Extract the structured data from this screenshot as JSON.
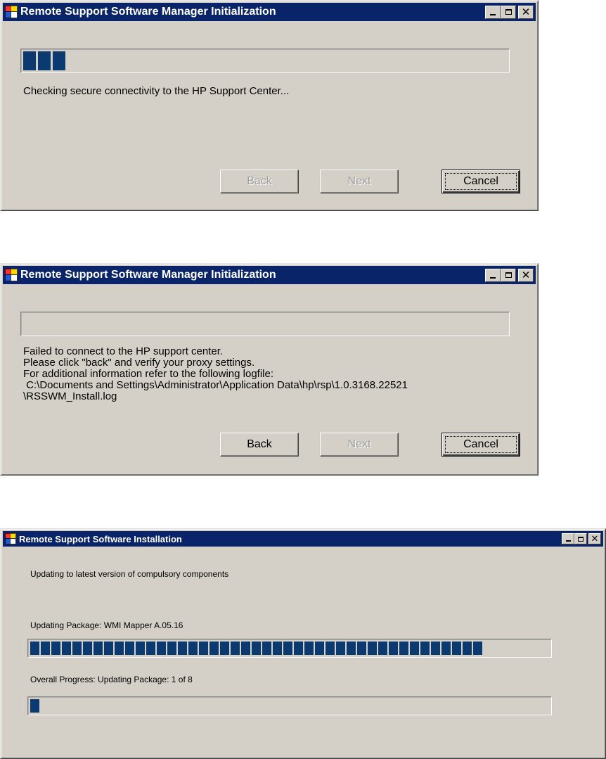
{
  "colors": {
    "titlebar": "#0a246a",
    "progress_fill": "#0a3a70",
    "window_face": "#d4d0c8"
  },
  "windows": [
    {
      "title": "Remote Support Software Manager Initialization",
      "progress_fraction": 0.09,
      "message_lines": [
        "Checking secure connectivity to the HP Support Center..."
      ],
      "buttons": {
        "back": "Back",
        "next": "Next",
        "cancel": "Cancel"
      },
      "back_enabled": false,
      "next_enabled": false
    },
    {
      "title": "Remote Support Software Manager Initialization",
      "progress_fraction": 0,
      "message_lines": [
        "Failed to connect to the HP support center.",
        "Please click \"back\" and verify your proxy settings.",
        "For additional information refer to the following logfile:",
        " C:\\Documents and Settings\\Administrator\\Application Data\\hp\\rsp\\1.0.3168.22521",
        "\\RSSWM_Install.log"
      ],
      "buttons": {
        "back": "Back",
        "next": "Next",
        "cancel": "Cancel"
      },
      "back_enabled": true,
      "next_enabled": false
    },
    {
      "title": "Remote Support Software Installation",
      "status": "Updating to latest version of compulsory components",
      "package_label": "Updating Package:  WMI Mapper A.05.16",
      "package_progress_fraction": 0.88,
      "overall_label": "Overall Progress: Updating Package:  1 of 8",
      "overall_progress_fraction": 0.02
    }
  ]
}
